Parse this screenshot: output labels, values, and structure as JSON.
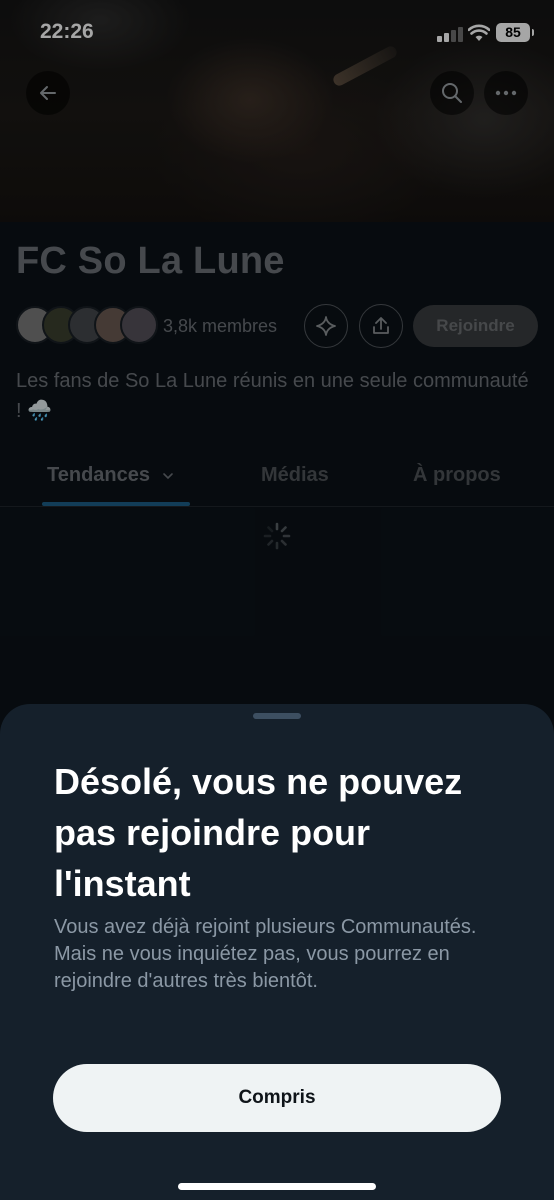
{
  "status_bar": {
    "time": "22:26",
    "battery": "85"
  },
  "community": {
    "name": "FC So La Lune",
    "members": "3,8k membres",
    "join_label": "Rejoindre",
    "description": "Les fans de So La Lune réunis en une seule communauté ! 🌧️"
  },
  "tabs": [
    {
      "label": "Tendances",
      "active": true
    },
    {
      "label": "Médias"
    },
    {
      "label": "À propos"
    }
  ],
  "dialog": {
    "title": "Désolé, vous ne pouvez pas rejoindre pour l'instant",
    "body": "Vous avez déjà rejoint plusieurs Communautés. Mais ne vous inquiétez pas, vous pourrez en rejoindre d'autres très bientôt.",
    "button": "Compris"
  },
  "icons": {
    "back": "back-arrow-icon",
    "search": "search-icon",
    "more": "more-icon",
    "sparkle": "sparkle-icon",
    "share": "share-icon",
    "chevron": "chevron-down-icon",
    "spinner": "loading-spinner-icon"
  },
  "colors": {
    "accent": "#1d9bf0",
    "sheet_bg": "#15202b",
    "button_bg": "#eff3f4"
  }
}
